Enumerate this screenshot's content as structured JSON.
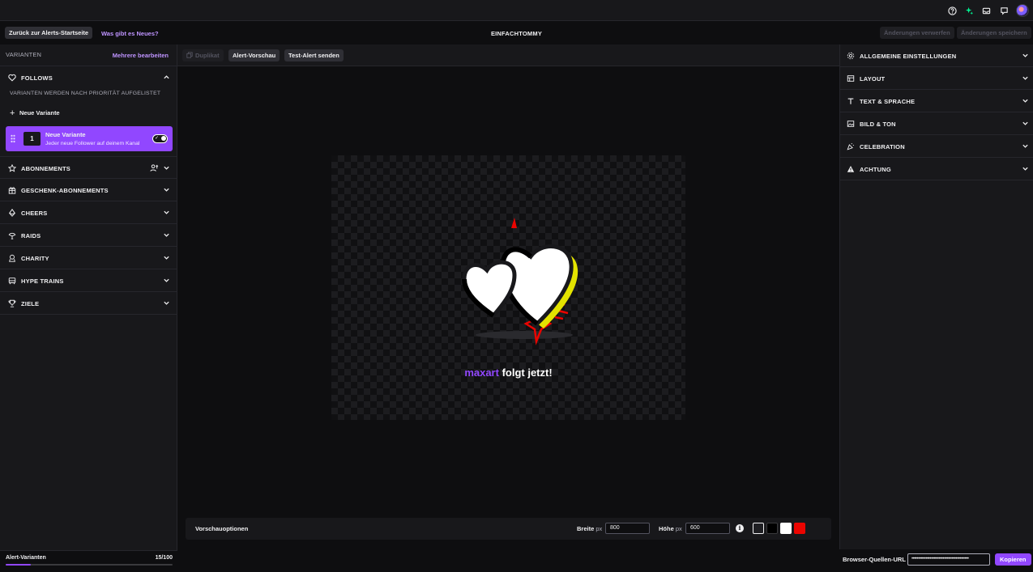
{
  "header": {
    "back_label": "Zurück zur Alerts-Startseite",
    "whats_new_label": "Was gibt es Neues?",
    "channel": "EINFACHTOMMY",
    "discard_label": "Änderungen verwerfen",
    "save_label": "Änderungen speichern"
  },
  "topbar_icons": [
    "help-icon",
    "sparkle-icon",
    "inbox-icon",
    "whisper-icon",
    "user-avatar"
  ],
  "left": {
    "title": "VARIANTEN",
    "edit_multiple": "Mehrere bearbeiten",
    "follows": {
      "label": "FOLLOWS",
      "note": "VARIANTEN WERDEN NACH PRIORITÄT AUFGELISTET",
      "add_variant": "Neue Variante",
      "variant": {
        "number": "1",
        "name": "Neue Variante",
        "description": "Jeder neue Follower auf deinem Kanal",
        "enabled": true
      }
    },
    "categories": [
      {
        "label": "ABONNEMENTS",
        "icon": "star-icon"
      },
      {
        "label": "GESCHENK-ABONNEMENTS",
        "icon": "gift-icon"
      },
      {
        "label": "CHEERS",
        "icon": "bits-icon"
      },
      {
        "label": "RAIDS",
        "icon": "raid-icon"
      },
      {
        "label": "CHARITY",
        "icon": "charity-icon"
      },
      {
        "label": "HYPE TRAINS",
        "icon": "train-icon"
      },
      {
        "label": "ZIELE",
        "icon": "trophy-icon"
      }
    ],
    "footer": {
      "label": "Alert-Varianten",
      "count": "15/100",
      "progress": 0.15
    }
  },
  "toolbar": {
    "duplicate": "Duplikat",
    "preview": "Alert-Vorschau",
    "test": "Test-Alert senden"
  },
  "alert": {
    "username": "maxart",
    "message": " folgt jetzt!"
  },
  "preview_options": {
    "label": "Vorschauoptionen",
    "width_label": "Breite",
    "height_label": "Höhe",
    "unit": "px",
    "width_value": "800",
    "height_value": "600",
    "swatches": [
      "#1f1f23",
      "#000000",
      "#ffffff",
      "#eb0400"
    ]
  },
  "right": {
    "sections": [
      {
        "label": "ALLGEMEINE EINSTELLUNGEN",
        "icon": "gear-icon"
      },
      {
        "label": "LAYOUT",
        "icon": "layout-icon"
      },
      {
        "label": "TEXT & SPRACHE",
        "icon": "text-icon"
      },
      {
        "label": "BILD & TON",
        "icon": "image-icon"
      },
      {
        "label": "CELEBRATION",
        "icon": "celebration-icon"
      },
      {
        "label": "ACHTUNG",
        "icon": "warning-icon"
      }
    ]
  },
  "browser_source": {
    "label": "Browser-Quellen-URL",
    "value": "••••••••••••••••••••••••••••••••••••••••••••",
    "copy_label": "Kopieren"
  },
  "colors": {
    "accent": "#9147ff",
    "accent_text": "#bf94ff",
    "background": "#0e0e10",
    "panel": "#18181b"
  }
}
